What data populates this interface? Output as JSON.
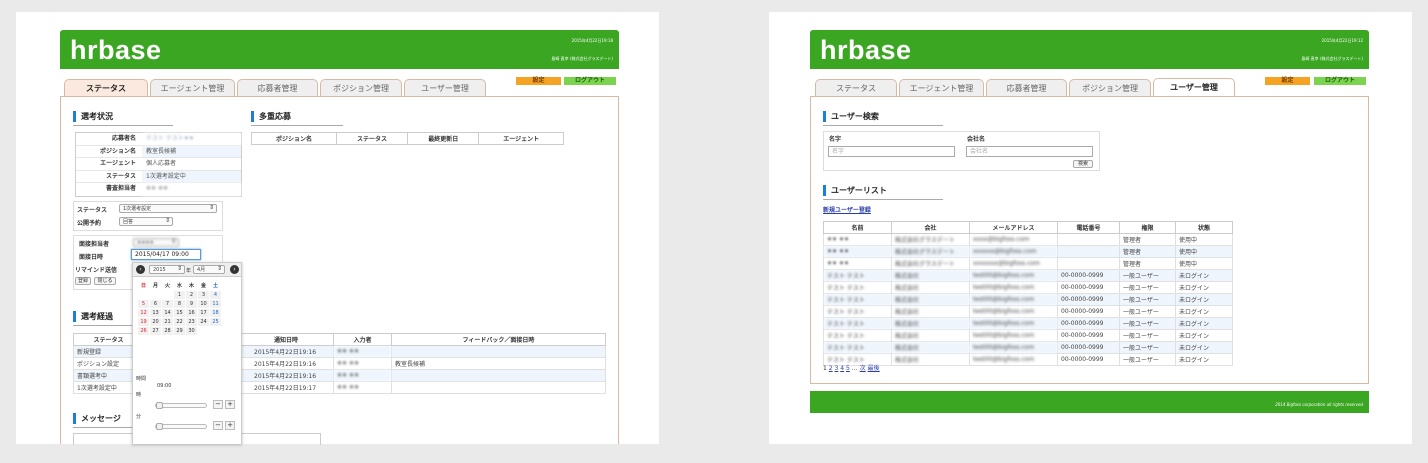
{
  "left": {
    "logo": "hrbase",
    "header_datetime": "2015年4月22日19:18",
    "header_user": "島崎 直幸 (株式会社グラスデート)",
    "tabs": [
      "ステータス",
      "エージェント管理",
      "応募者管理",
      "ポジション管理",
      "ユーザー管理"
    ],
    "settings_label": "設定",
    "logout_label": "ログアウト",
    "selection_status": {
      "title": "選考状況",
      "rows": [
        {
          "key": "応募者名",
          "value": "テスト テスト⚫⚫"
        },
        {
          "key": "ポジション名",
          "value": "教室長候補"
        },
        {
          "key": "エージェント",
          "value": "個人応募者"
        },
        {
          "key": "ステータス",
          "value": "1次選考設定中"
        },
        {
          "key": "書査担当者",
          "value": "⚫⚫ ⚫⚫"
        }
      ]
    },
    "form": {
      "status_label": "ステータス",
      "status_value": "1次選考設定",
      "publish_label": "公開予約",
      "publish_value": "回答",
      "interviewer_label": "面接担当者",
      "interviewer_value": "⚫⚫⚫⚫",
      "date_label": "面接日時",
      "date_value": "2015/04/17 09:00",
      "remind_label": "リマインド送信",
      "register_btn": "登録",
      "close_btn": "閉じる"
    },
    "calendar": {
      "year": "2015",
      "year_suffix": "年",
      "month": "4月",
      "weekdays": [
        "日",
        "月",
        "火",
        "水",
        "木",
        "金",
        "土"
      ],
      "weeks": [
        [
          "",
          "",
          "",
          "1",
          "2",
          "3",
          "4"
        ],
        [
          "5",
          "6",
          "7",
          "8",
          "9",
          "10",
          "11"
        ],
        [
          "12",
          "13",
          "14",
          "15",
          "16",
          "17",
          "18"
        ],
        [
          "19",
          "20",
          "21",
          "22",
          "23",
          "24",
          "25"
        ],
        [
          "26",
          "27",
          "28",
          "29",
          "30",
          "",
          ""
        ]
      ],
      "time_label": "時間",
      "time_value": "09:00",
      "hour_label": "時",
      "minute_label": "分"
    },
    "multi_apply": {
      "title": "多重応募",
      "headers": [
        "ポジション名",
        "ステータス",
        "最終更新日",
        "エージェント"
      ]
    },
    "history": {
      "title": "選考経過",
      "headers": [
        "ステータス",
        "通知日時",
        "入力者",
        "フィードバック／面接日時"
      ],
      "rows": [
        {
          "status": "新規登録",
          "date": "2015年4月22日19:16",
          "user": "⚫⚫ ⚫⚫",
          "feedback": ""
        },
        {
          "status": "ポジション設定",
          "date": "2015年4月22日19:16",
          "user": "⚫⚫ ⚫⚫",
          "feedback": "教室長候補"
        },
        {
          "status": "書類選考中",
          "date": "2015年4月22日19:16",
          "user": "⚫⚫ ⚫⚫",
          "feedback": ""
        },
        {
          "status": "1次選考設定中",
          "date": "2015年4月22日19:17",
          "user": "⚫⚫ ⚫⚫",
          "feedback": ""
        }
      ]
    },
    "message_title": "メッセージ"
  },
  "right": {
    "logo": "hrbase",
    "header_datetime": "2015年4月22日19:12",
    "header_user": "島崎 直幸 (株式会社グラスデート)",
    "tabs": [
      "ステータス",
      "エージェント管理",
      "応募者管理",
      "ポジション管理",
      "ユーザー管理"
    ],
    "settings_label": "設定",
    "logout_label": "ログアウト",
    "search": {
      "title": "ユーザー検索",
      "name_label": "名字",
      "name_placeholder": "名字",
      "company_label": "会社名",
      "company_placeholder": "会社名",
      "search_btn": "検索"
    },
    "user_list": {
      "title": "ユーザーリスト",
      "new_user_link": "新規ユーザー登録",
      "headers": [
        "名前",
        "会社",
        "メールアドレス",
        "電話番号",
        "権限",
        "状態"
      ],
      "rows": [
        {
          "name": "⚫⚫ ⚫⚫",
          "company": "株式会社グラスデート",
          "email": "xxxx@bigfoss.com",
          "phone": "",
          "role": "管理者",
          "state": "使用中"
        },
        {
          "name": "⚫⚫ ⚫⚫",
          "company": "株式会社グラスデート",
          "email": "xxxxxx@bigfoss.com",
          "phone": "",
          "role": "管理者",
          "state": "使用中"
        },
        {
          "name": "⚫⚫ ⚫⚫",
          "company": "株式会社グラスデート",
          "email": "xxxxxxx@bigfoss.com",
          "phone": "",
          "role": "管理者",
          "state": "使用中"
        },
        {
          "name": "テスト テスト",
          "company": "株式会社",
          "email": "test00@bigfoss.com",
          "phone": "00-0000-0999",
          "role": "一般ユーザー",
          "state": "未ログイン"
        },
        {
          "name": "テスト テスト",
          "company": "株式会社",
          "email": "test00@bigfoss.com",
          "phone": "00-0000-0999",
          "role": "一般ユーザー",
          "state": "未ログイン"
        },
        {
          "name": "テスト テスト",
          "company": "株式会社",
          "email": "test00@bigfoss.com",
          "phone": "00-0000-0999",
          "role": "一般ユーザー",
          "state": "未ログイン"
        },
        {
          "name": "テスト テスト",
          "company": "株式会社",
          "email": "test00@bigfoss.com",
          "phone": "00-0000-0999",
          "role": "一般ユーザー",
          "state": "未ログイン"
        },
        {
          "name": "テスト テスト",
          "company": "株式会社",
          "email": "test00@bigfoss.com",
          "phone": "00-0000-0999",
          "role": "一般ユーザー",
          "state": "未ログイン"
        },
        {
          "name": "テスト テスト",
          "company": "株式会社",
          "email": "test00@bigfoss.com",
          "phone": "00-0000-0999",
          "role": "一般ユーザー",
          "state": "未ログイン"
        },
        {
          "name": "テスト テスト",
          "company": "株式会社",
          "email": "test00@bigfoss.com",
          "phone": "00-0000-0999",
          "role": "一般ユーザー",
          "state": "未ログイン"
        },
        {
          "name": "テスト テスト",
          "company": "株式会社",
          "email": "test00@bigfoss.com",
          "phone": "00-0000-0999",
          "role": "一般ユーザー",
          "state": "未ログイン"
        }
      ],
      "pager_pages": [
        "1",
        "2",
        "3",
        "4",
        "5"
      ],
      "pager_more": "…",
      "pager_next": "次",
      "pager_last": "最後"
    },
    "footer_text": "2014 Bigfoss corporation all rights reserved"
  }
}
